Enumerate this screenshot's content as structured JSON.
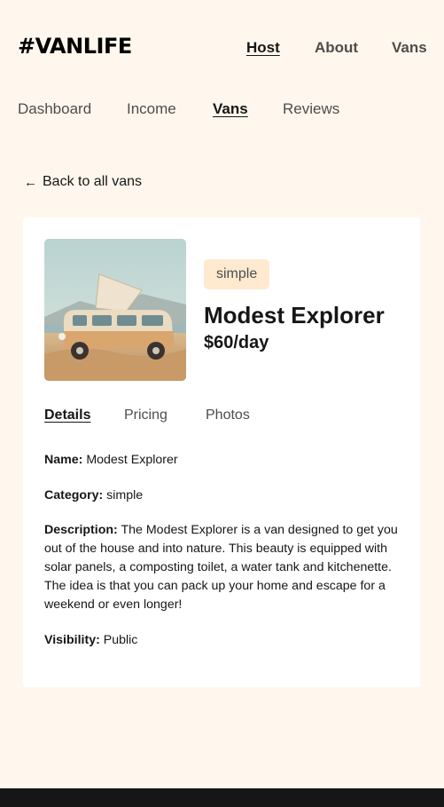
{
  "header": {
    "logo": "#VANLIFE",
    "nav": [
      {
        "label": "Host",
        "active": true
      },
      {
        "label": "About",
        "active": false
      },
      {
        "label": "Vans",
        "active": false
      }
    ]
  },
  "host_nav": [
    {
      "label": "Dashboard",
      "active": false
    },
    {
      "label": "Income",
      "active": false
    },
    {
      "label": "Vans",
      "active": true
    },
    {
      "label": "Reviews",
      "active": false
    }
  ],
  "back_link": {
    "arrow": "←",
    "label": "Back to all vans"
  },
  "van": {
    "type_badge": "simple",
    "name": "Modest Explorer",
    "price": "$60/day"
  },
  "tabs": [
    {
      "label": "Details",
      "active": true
    },
    {
      "label": "Pricing",
      "active": false
    },
    {
      "label": "Photos",
      "active": false
    }
  ],
  "details": {
    "name_label": "Name:",
    "name_value": " Modest Explorer",
    "category_label": "Category:",
    "category_value": " simple",
    "description_label": "Description:",
    "description_value": " The Modest Explorer is a van designed to get you out of the house and into nature. This beauty is equipped with solar panels, a composting toilet, a water tank and kitchenette. The idea is that you can pack up your home and escape for a weekend or even longer!",
    "visibility_label": "Visibility:",
    "visibility_value": " Public"
  },
  "colors": {
    "background": "#FFF7ED",
    "badge_bg": "#FFEAD0",
    "footer": "#161616"
  }
}
